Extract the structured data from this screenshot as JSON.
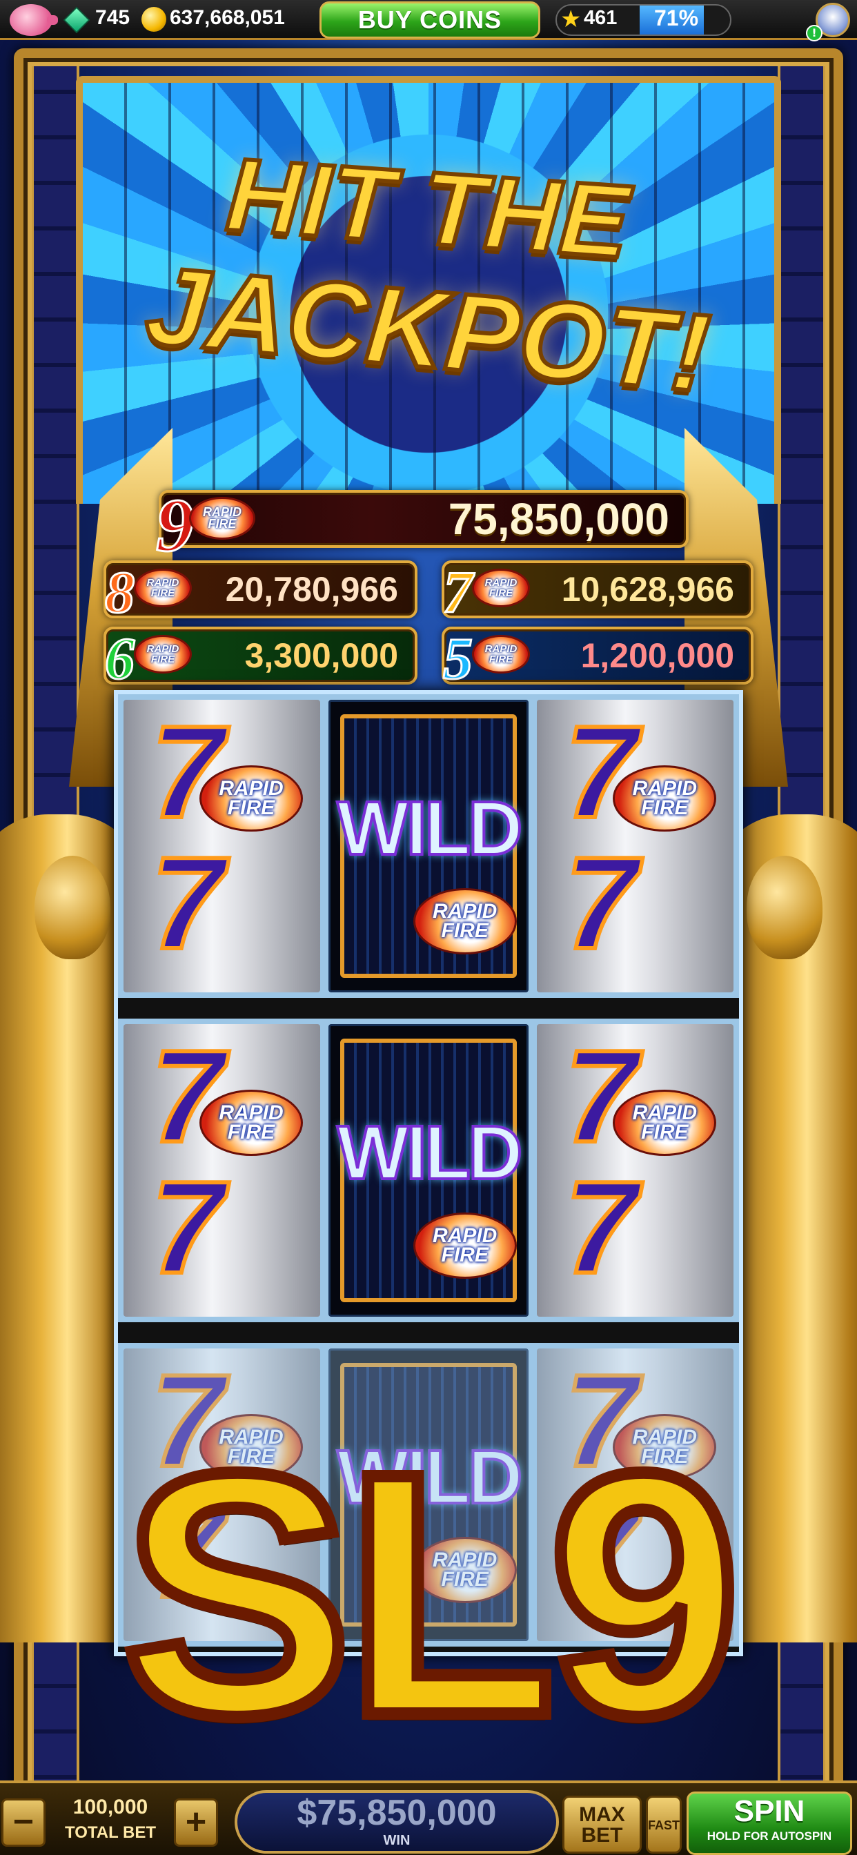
{
  "topbar": {
    "gems": "745",
    "coins": "637,668,051",
    "buy_label": "BUY COINS",
    "level": "461",
    "xp_percent": "71%",
    "xp_progress": 0.71,
    "notification_badge": "!"
  },
  "headline": {
    "line1": "HIT THE",
    "line2": "JACKPOT!"
  },
  "jackpots": {
    "j9": {
      "number": "9",
      "badge": "RAPID FIRE",
      "value": "75,850,000"
    },
    "j8": {
      "number": "8",
      "badge": "RAPID FIRE",
      "value": "20,780,966"
    },
    "j7": {
      "number": "7",
      "badge": "RAPID FIRE",
      "value": "10,628,966"
    },
    "j6": {
      "number": "6",
      "badge": "RAPID FIRE",
      "value": "3,300,000"
    },
    "j5": {
      "number": "5",
      "badge": "RAPID FIRE",
      "value": "1,200,000"
    }
  },
  "reels": {
    "wild_text": "WILD",
    "seven_symbol": "7",
    "rapid_fire_text": "RAPID FIRE",
    "grid": [
      [
        "seven-rapid-fire",
        "wild-rapid-fire",
        "seven-rapid-fire"
      ],
      [
        "seven-rapid-fire",
        "wild-rapid-fire",
        "seven-rapid-fire"
      ],
      [
        "seven-rapid-fire",
        "wild-rapid-fire",
        "seven-rapid-fire"
      ]
    ]
  },
  "overlay": {
    "text": "SL9"
  },
  "bottombar": {
    "minus": "−",
    "plus": "+",
    "total_bet_value": "100,000",
    "total_bet_label": "TOTAL BET",
    "win_value": "$75,850,000",
    "win_label": "WIN",
    "max_bet_label": "MAX BET",
    "fast_label": "FAST",
    "spin_label": "SPIN",
    "spin_sub": "HOLD FOR AUTOSPIN"
  },
  "colors": {
    "gold": "#e2ab3e",
    "coin_green": "#2da51a",
    "xp_blue": "#1a6fd8",
    "sl9_yellow": "#f4c510"
  }
}
